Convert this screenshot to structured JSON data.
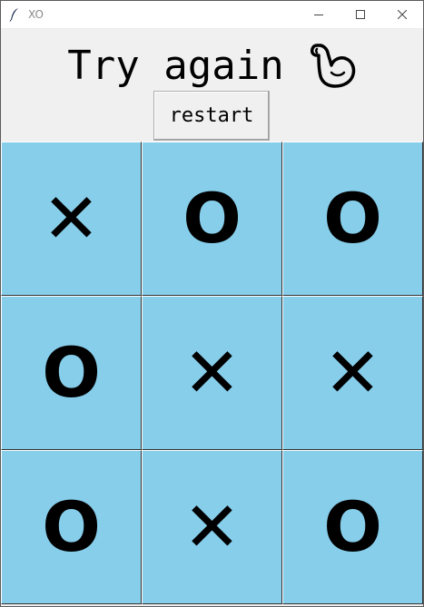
{
  "window": {
    "title": "XO",
    "controls": {
      "minimize": "minimize-icon",
      "maximize": "maximize-icon",
      "close": "close-icon"
    }
  },
  "header": {
    "status_text": "Try again",
    "status_icon": "flexed-biceps-icon",
    "restart_label": "restart"
  },
  "colors": {
    "cell_background": "#87ceeb",
    "header_background": "#f0f0f0",
    "mark_color": "#000000"
  },
  "board": {
    "cells": [
      {
        "mark": "✕"
      },
      {
        "mark": "O"
      },
      {
        "mark": "O"
      },
      {
        "mark": "O"
      },
      {
        "mark": "✕"
      },
      {
        "mark": "✕"
      },
      {
        "mark": "O"
      },
      {
        "mark": "✕"
      },
      {
        "mark": "O"
      }
    ]
  }
}
